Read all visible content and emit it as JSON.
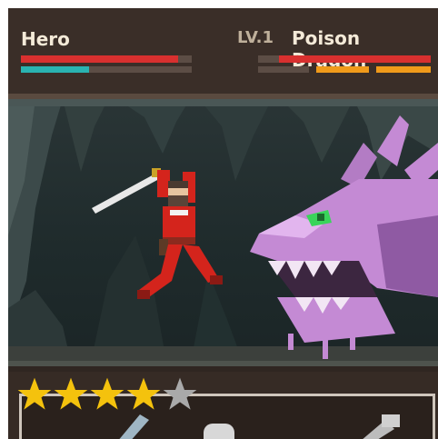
{
  "hud": {
    "hero_name": "Hero",
    "hero_health": 0.92,
    "hero_energy": 0.4,
    "enemy_level": "LV.1",
    "enemy_name": "Poison Dragon",
    "enemy_health": 0.88
  },
  "rating": {
    "value": 4,
    "max": 5
  },
  "colors": {
    "health": "#d8302f",
    "energy": "#2ab3b1",
    "enemy_energy": "#f09a1a",
    "star_filled": "#f4c20d",
    "star_empty": "#a9a9a9",
    "dragon": "#c48ad4"
  },
  "scene": {
    "hero": "red-armored-swordsman",
    "enemy": "purple-dragon"
  }
}
